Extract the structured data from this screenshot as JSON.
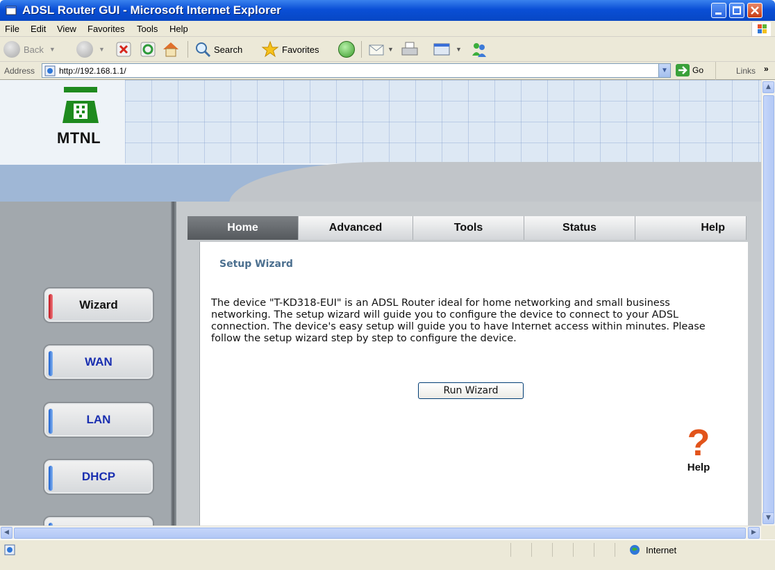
{
  "window": {
    "title": "ADSL Router GUI - Microsoft Internet Explorer"
  },
  "menu": [
    "File",
    "Edit",
    "View",
    "Favorites",
    "Tools",
    "Help"
  ],
  "toolbar": {
    "back_label": "Back",
    "search_label": "Search",
    "favorites_label": "Favorites"
  },
  "address": {
    "label": "Address",
    "url": "http://192.168.1.1/",
    "go_label": "Go",
    "links_label": "Links"
  },
  "logo": {
    "text": "MTNL"
  },
  "tabs": [
    {
      "label": "Home",
      "active": true
    },
    {
      "label": "Advanced",
      "active": false
    },
    {
      "label": "Tools",
      "active": false
    },
    {
      "label": "Status",
      "active": false
    },
    {
      "label": "Help",
      "active": false
    }
  ],
  "sidebar": {
    "items": [
      {
        "label": "Wizard",
        "active": true
      },
      {
        "label": "WAN",
        "active": false
      },
      {
        "label": "LAN",
        "active": false
      },
      {
        "label": "DHCP",
        "active": false
      }
    ]
  },
  "content": {
    "title": "Setup Wizard",
    "description": "The device \"T-KD318-EUI\" is an ADSL Router ideal for home networking and small business networking. The setup wizard will guide you to configure the device to connect to your ADSL connection. The device's easy setup will guide you to have Internet access within minutes. Please follow the setup wizard step by step to configure the device.",
    "run_wizard_label": "Run Wizard",
    "help_label": "Help"
  },
  "statusbar": {
    "zone": "Internet"
  },
  "colors": {
    "titlebar": "#0a4fd6",
    "tab_active": "#5f6367",
    "accent_red": "#c0141c",
    "link_blue": "#1a2fb0",
    "help_orange": "#e2541b"
  }
}
